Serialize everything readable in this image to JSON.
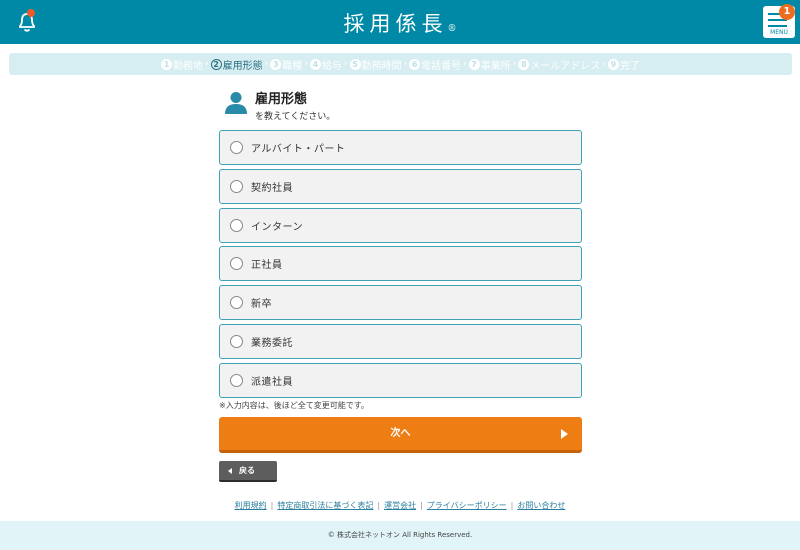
{
  "header": {
    "logo": "採用係長",
    "logo_mark": "®",
    "menu_label": "MENU",
    "menu_badge": "1"
  },
  "steps": [
    {
      "num": "1",
      "label": "勤務地"
    },
    {
      "num": "2",
      "label": "雇用形態",
      "active": true
    },
    {
      "num": "3",
      "label": "職種"
    },
    {
      "num": "4",
      "label": "給与"
    },
    {
      "num": "5",
      "label": "勤務時間"
    },
    {
      "num": "6",
      "label": "電話番号"
    },
    {
      "num": "7",
      "label": "事業所"
    },
    {
      "num": "8",
      "label": "メールアドレス"
    },
    {
      "num": "9",
      "label": "完了"
    }
  ],
  "question": {
    "title": "雇用形態",
    "subtitle": "を教えてください。"
  },
  "options": [
    {
      "label": "アルバイト・パート"
    },
    {
      "label": "契約社員"
    },
    {
      "label": "インターン"
    },
    {
      "label": "正社員"
    },
    {
      "label": "新卒"
    },
    {
      "label": "業務委託"
    },
    {
      "label": "派遣社員"
    }
  ],
  "note": "※入力内容は、後ほど全て変更可能です。",
  "buttons": {
    "next": "次へ",
    "back": "戻る"
  },
  "footer_links": [
    "利用規約",
    "特定商取引法に基づく表記",
    "運営会社",
    "プライバシーポリシー",
    "お問い合わせ"
  ],
  "copyright": "© 株式会社ネットオン All Rights Reserved.",
  "colors": {
    "header": "#0089a6",
    "accent": "#ee7d14",
    "badge": "#ee6c1f"
  }
}
